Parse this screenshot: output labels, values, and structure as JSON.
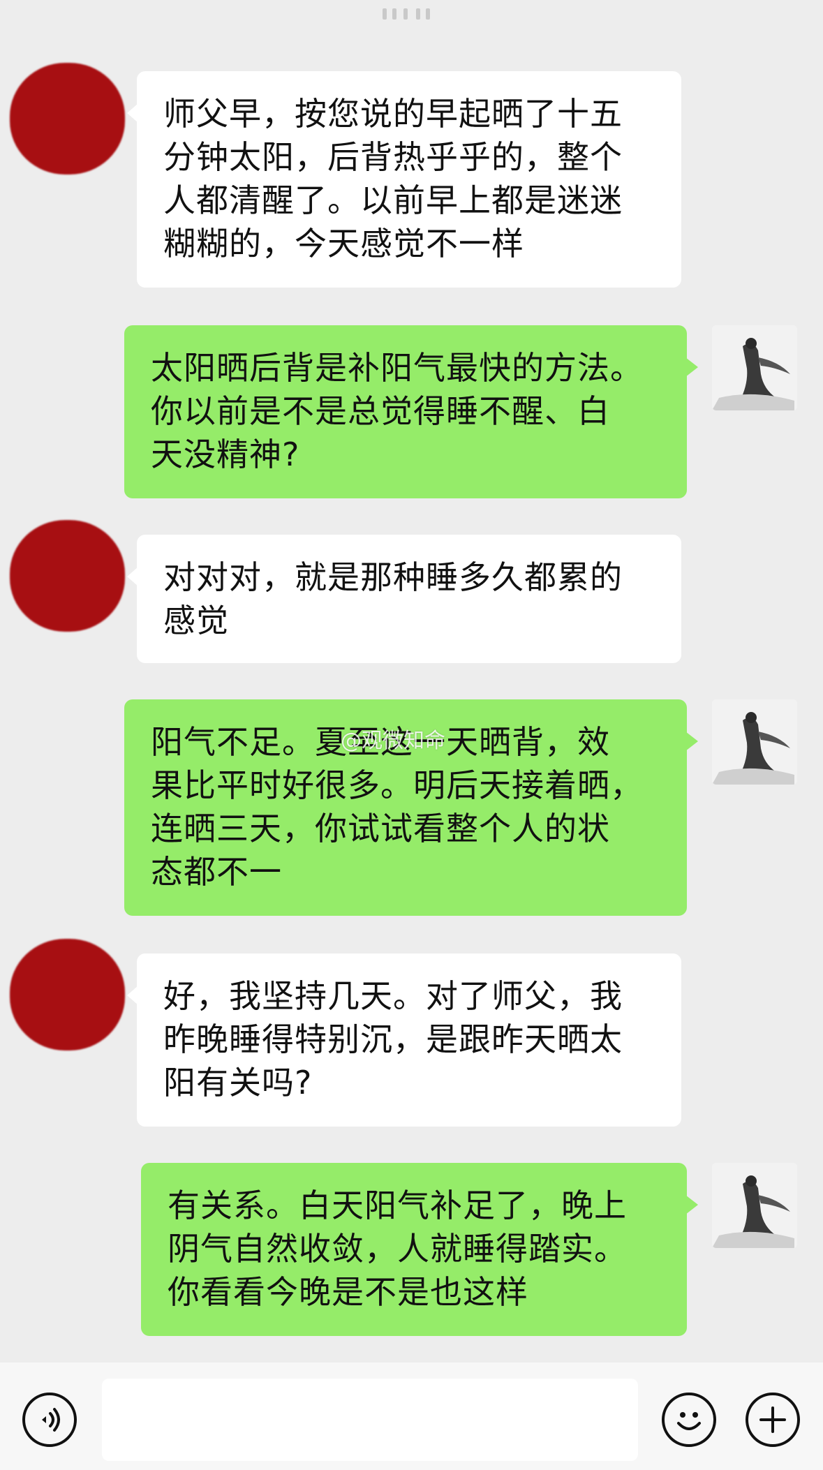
{
  "messages": [
    {
      "side": "in",
      "text": "师父早，按您说的早起晒了十五\n分钟太阳，后背热乎乎的，整个\n人都清醒了。以前早上都是迷迷\n糊糊的，今天感觉不一样"
    },
    {
      "side": "out",
      "text": "太阳晒后背是补阳气最快的方法。\n你以前是不是总觉得睡不醒、白\n天没精神?"
    },
    {
      "side": "in",
      "text": "对对对，就是那种睡多久都累的\n感觉"
    },
    {
      "side": "out",
      "text": "阳气不足。夏至这一天晒背，效\n果比平时好很多。明后天接着晒，\n连晒三天，你试试看整个人的状\n态都不一"
    },
    {
      "side": "in",
      "text": "好，我坚持几天。对了师父，我\n昨晚睡得特别沉，是跟昨天晒太\n阳有关吗?"
    },
    {
      "side": "out",
      "text": "有关系。白天阳气补足了，晚上\n阴气自然收敛，人就睡得踏实。\n你看看今晚是不是也这样"
    }
  ],
  "watermark": "@观微知命",
  "icons": {
    "voice": "voice-icon",
    "emoji": "emoji-icon",
    "plus": "plus-icon"
  },
  "colors": {
    "background": "#ededed",
    "outgoing_bubble": "#95ec69",
    "incoming_bubble": "#ffffff",
    "redacted_avatar": "#a70f12"
  }
}
